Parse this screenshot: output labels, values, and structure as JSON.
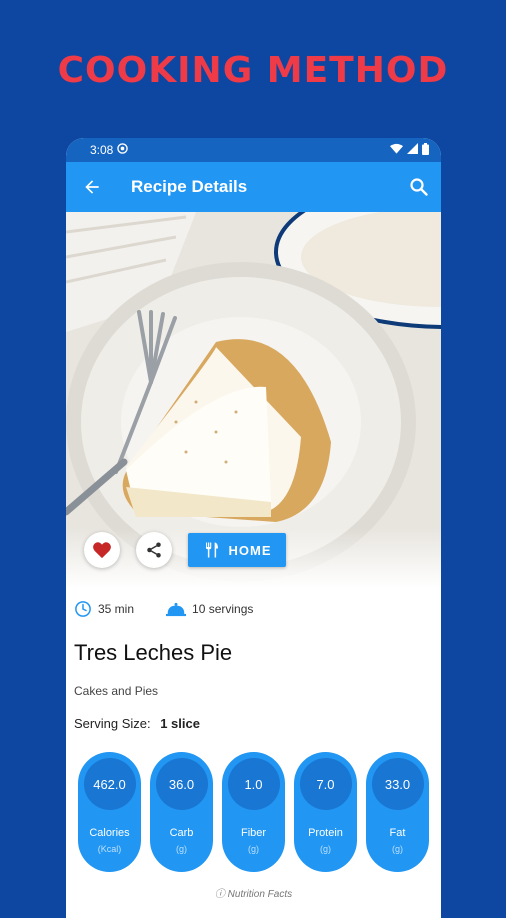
{
  "banner": {
    "headline": "COOKING METHOD"
  },
  "status_bar": {
    "time": "3:08"
  },
  "app_bar": {
    "title": "Recipe Details"
  },
  "actions": {
    "home_label": "HOME"
  },
  "meta": {
    "time": "35 min",
    "servings": "10 servings"
  },
  "recipe": {
    "title": "Tres Leches Pie",
    "category": "Cakes and Pies",
    "serving_label": "Serving Size:",
    "serving_value": "1 slice"
  },
  "nutrition": [
    {
      "value": "462.0",
      "label": "Calories",
      "unit": "(Kcal)"
    },
    {
      "value": "36.0",
      "label": "Carb",
      "unit": "(g)"
    },
    {
      "value": "1.0",
      "label": "Fiber",
      "unit": "(g)"
    },
    {
      "value": "7.0",
      "label": "Protein",
      "unit": "(g)"
    },
    {
      "value": "33.0",
      "label": "Fat",
      "unit": "(g)"
    }
  ],
  "footer": {
    "note": "Nutrition Facts"
  },
  "colors": {
    "background": "#0d47a1",
    "primary": "#2196f3",
    "headline": "#ef3b48",
    "heart": "#c62828"
  }
}
